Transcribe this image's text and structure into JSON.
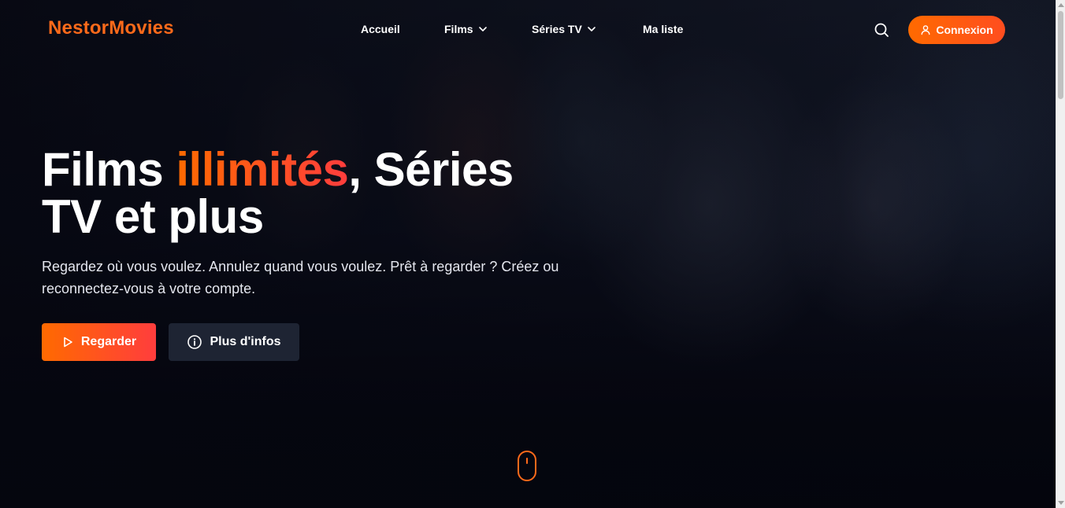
{
  "nav": {
    "logo": "NestorMovies",
    "links": [
      {
        "label": "Accueil"
      },
      {
        "label": "Films"
      },
      {
        "label": "Séries TV"
      },
      {
        "label": "Ma liste"
      }
    ],
    "login_label": "Connexion",
    "icons": {
      "search": "search-icon",
      "user": "user-icon",
      "chevron": "chevron-down-icon"
    }
  },
  "hero": {
    "title_part1": "Films ",
    "title_accent": "illimités",
    "title_part2": ", Séries TV et plus",
    "subtitle": "Regardez où vous voulez. Annulez quand vous voulez. Prêt à regarder ? Créez ou reconnectez-vous à votre compte.",
    "watch_label": "Regarder",
    "info_label": "Plus d'infos",
    "icons": {
      "watch": "play-icon",
      "info": "info-icon",
      "scroll": "scroll-mouse-icon"
    }
  },
  "colors": {
    "accent": "#ff6a1a",
    "accent_gradient_end": "#ff3d3d",
    "background": "#05060f",
    "secondary_button": "#1e2433"
  }
}
